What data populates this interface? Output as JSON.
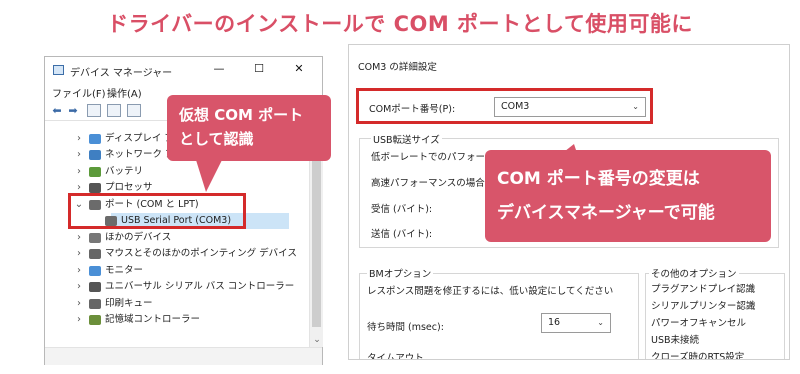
{
  "headline": "ドライバーのインストールで COM ポートとして使用可能に",
  "device_manager": {
    "title": "デバイス マネージャー",
    "window_controls": {
      "minimize": "—",
      "maximize": "☐",
      "close": "✕"
    },
    "menu": [
      "ファイル(F)",
      "操作(A)"
    ],
    "toolbar": {
      "back": "⬅",
      "forward": "➡"
    },
    "tree": [
      {
        "label": "ディスプレイ ア",
        "expanded": false,
        "icon_color": "#4a8fd6"
      },
      {
        "label": "ネットワーク ア",
        "expanded": false,
        "icon_color": "#3f7fc2"
      },
      {
        "label": "バッテリ",
        "expanded": false,
        "icon_color": "#5c9a3a"
      },
      {
        "label": "プロセッサ",
        "expanded": false,
        "icon_color": "#555555"
      },
      {
        "label": "ポート (COM と LPT)",
        "expanded": true,
        "icon_color": "#6b6b6b"
      },
      {
        "label": "USB Serial Port (COM3)",
        "child": true,
        "selected": true,
        "icon_color": "#6b6b6b"
      },
      {
        "label": "ほかのデバイス",
        "expanded": false,
        "icon_color": "#777777"
      },
      {
        "label": "マウスとそのほかのポインティング デバイス",
        "expanded": false,
        "icon_color": "#666666"
      },
      {
        "label": "モニター",
        "expanded": false,
        "icon_color": "#4a8fd6"
      },
      {
        "label": "ユニバーサル シリアル バス コントローラー",
        "expanded": false,
        "icon_color": "#555555"
      },
      {
        "label": "印刷キュー",
        "expanded": false,
        "icon_color": "#666666"
      },
      {
        "label": "記憶域コントローラー",
        "expanded": false,
        "icon_color": "#6b8f3a"
      }
    ],
    "expand_glyph": "›",
    "collapse_glyph": "⌄",
    "scroll_down": "⌄"
  },
  "callout_virtual": {
    "line1": "仮想 COM ポート",
    "line2": "として認識"
  },
  "callout_change": {
    "line1": "COM ポート番号の変更は",
    "line2": "デバイスマネージャーで可能"
  },
  "properties": {
    "title": "COM3 の詳細設定",
    "port_number_label": "COMポート番号(P):",
    "port_number_value": "COM3",
    "usb_transfer_heading": "USB転送サイズ",
    "low_baud_label": "低ボーレートでのパフォーマ",
    "high_perf_label": "高速パフォーマンスの場合は",
    "receive_label": "受信 (バイト):",
    "send_label": "送信 (バイト):",
    "bm_heading": "BMオプション",
    "bm_desc": "レスポンス問題を修正するには、低い設定にしてください",
    "latency_label": "待ち時間 (msec):",
    "latency_value": "16",
    "timeout_heading": "タイムアウト",
    "misc_heading": "その他のオプション",
    "misc_options": [
      "プラグアンドプレイ認識",
      "シリアルプリンター認識",
      "パワーオフキャンセル",
      "USB未接続",
      "クローズ時のRTS設定"
    ],
    "combo_arrow": "⌄"
  },
  "colors": {
    "headline": "#d94f66",
    "callout_bg": "#d8556a",
    "highlight": "#d42a2a",
    "selection": "#cce4f7"
  }
}
